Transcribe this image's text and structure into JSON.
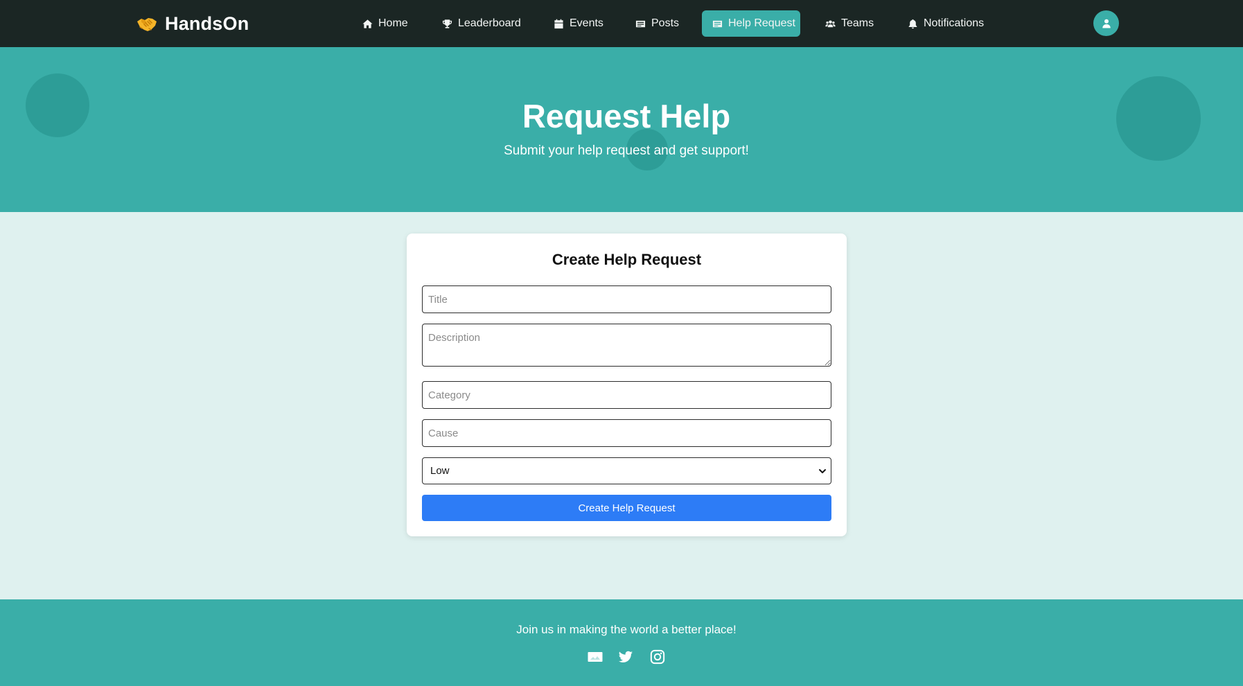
{
  "brand": {
    "name": "HandsOn",
    "icon": "handshake-icon",
    "icon_color": "#f5b428"
  },
  "nav": {
    "items": [
      {
        "label": "Home",
        "icon": "home-icon",
        "active": false
      },
      {
        "label": "Leaderboard",
        "icon": "trophy-icon",
        "active": false
      },
      {
        "label": "Events",
        "icon": "calendar-icon",
        "active": false
      },
      {
        "label": "Posts",
        "icon": "posts-icon",
        "active": false
      },
      {
        "label": "Help Request",
        "icon": "help-request-icon",
        "active": true
      },
      {
        "label": "Teams",
        "icon": "users-icon",
        "active": false
      },
      {
        "label": "Notifications",
        "icon": "bell-icon",
        "active": false
      }
    ],
    "avatar_icon": "user-icon"
  },
  "hero": {
    "title": "Request Help",
    "subtitle": "Submit your help request and get support!"
  },
  "form": {
    "heading": "Create Help Request",
    "title_placeholder": "Title",
    "description_placeholder": "Description",
    "category_placeholder": "Category",
    "cause_placeholder": "Cause",
    "urgency_value": "Low",
    "submit_label": "Create Help Request"
  },
  "footer": {
    "text": "Join us in making the world a better place!",
    "social": [
      "image-icon",
      "twitter-icon",
      "instagram-icon"
    ]
  },
  "colors": {
    "navbar": "#1b2624",
    "accent": "#3aaea8",
    "page_bg": "#dff1ef",
    "button": "#2d7cf6"
  }
}
